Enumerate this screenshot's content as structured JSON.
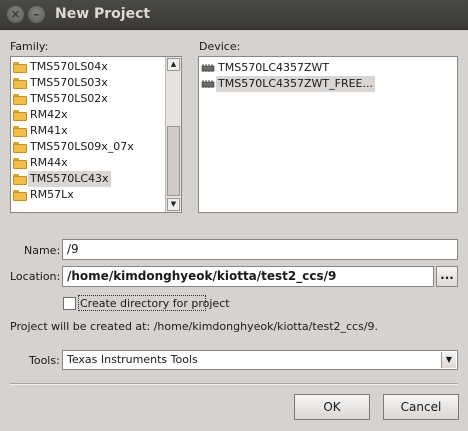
{
  "window": {
    "title": "New Project",
    "close_glyph": "×",
    "minimize_glyph": "–"
  },
  "family": {
    "label": "Family:",
    "items": [
      {
        "label": "TMS570LS04x",
        "icon": "folder-icon",
        "selected": false
      },
      {
        "label": "TMS570LS03x",
        "icon": "folder-icon",
        "selected": false
      },
      {
        "label": "TMS570LS02x",
        "icon": "folder-icon",
        "selected": false
      },
      {
        "label": "RM42x",
        "icon": "folder-icon",
        "selected": false
      },
      {
        "label": "RM41x",
        "icon": "folder-icon",
        "selected": false
      },
      {
        "label": "TMS570LS09x_07x",
        "icon": "folder-icon",
        "selected": false
      },
      {
        "label": "RM44x",
        "icon": "folder-icon",
        "selected": false
      },
      {
        "label": "TMS570LC43x",
        "icon": "open-folder-icon",
        "selected": true
      },
      {
        "label": "RM57Lx",
        "icon": "folder-icon",
        "selected": false
      }
    ],
    "scroll_up_glyph": "▲",
    "scroll_down_glyph": "▼"
  },
  "device": {
    "label": "Device:",
    "items": [
      {
        "label": "TMS570LC4357ZWT",
        "icon": "chip-icon",
        "selected": false
      },
      {
        "label": "TMS570LC4357ZWT_FREE...",
        "icon": "chip-icon",
        "selected": true
      }
    ]
  },
  "name": {
    "label": "Name:",
    "value": "/9"
  },
  "location": {
    "label": "Location:",
    "value": "/home/kimdonghyeok/kiotta/test2_ccs/9",
    "browse_label": "..."
  },
  "create_directory": {
    "label": "Create directory for project",
    "checked": false
  },
  "info_text": "Project will be created at: /home/kimdonghyeok/kiotta/test2_ccs/9.",
  "tools": {
    "label": "Tools:",
    "selected": "Texas Instruments Tools",
    "arrow_glyph": "▼"
  },
  "buttons": {
    "ok": "OK",
    "cancel": "Cancel"
  },
  "colors": {
    "titlebar": "#3e3d39",
    "window_bg": "#d6d2d0",
    "selection_bg": "#d9d6d3",
    "folder": "#f2bd44"
  }
}
